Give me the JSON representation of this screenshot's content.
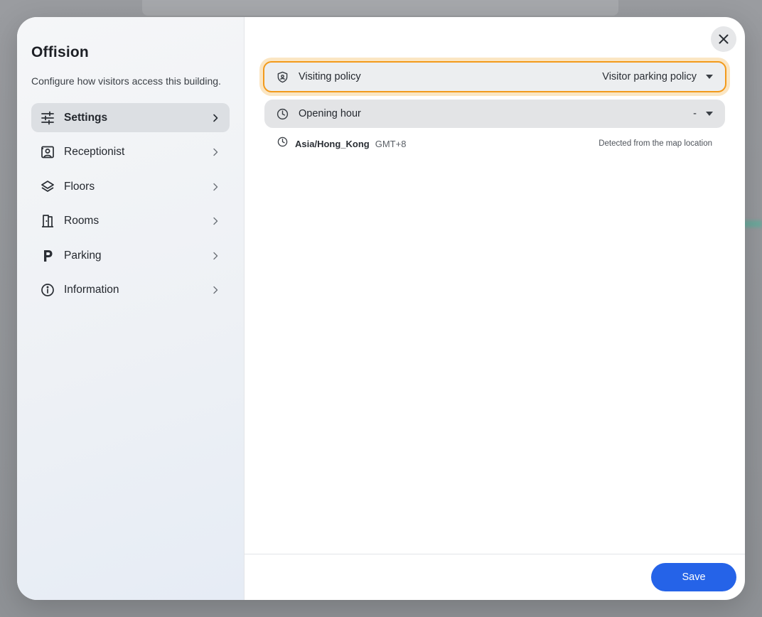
{
  "building": {
    "name": "Offision",
    "description": "Configure how visitors access this building."
  },
  "nav": [
    {
      "label": "Settings",
      "icon": "sliders-icon",
      "active": true
    },
    {
      "label": "Receptionist",
      "icon": "id-card-icon",
      "active": false
    },
    {
      "label": "Floors",
      "icon": "layers-icon",
      "active": false
    },
    {
      "label": "Rooms",
      "icon": "door-icon",
      "active": false
    },
    {
      "label": "Parking",
      "icon": "parking-icon",
      "active": false
    },
    {
      "label": "Information",
      "icon": "info-icon",
      "active": false
    }
  ],
  "settings": {
    "visiting_policy": {
      "label": "Visiting policy",
      "value": "Visitor parking policy",
      "icon": "shield-icon"
    },
    "opening_hour": {
      "label": "Opening hour",
      "value": "-",
      "icon": "clock-icon"
    },
    "timezone": {
      "name": "Asia/Hong_Kong",
      "offset": "GMT+8",
      "note": "Detected from the map location",
      "icon": "clock-icon"
    }
  },
  "actions": {
    "save_label": "Save",
    "close_icon": "close-icon"
  },
  "colors": {
    "accent": "#2563e8",
    "focus_ring": "#f29a1b"
  }
}
